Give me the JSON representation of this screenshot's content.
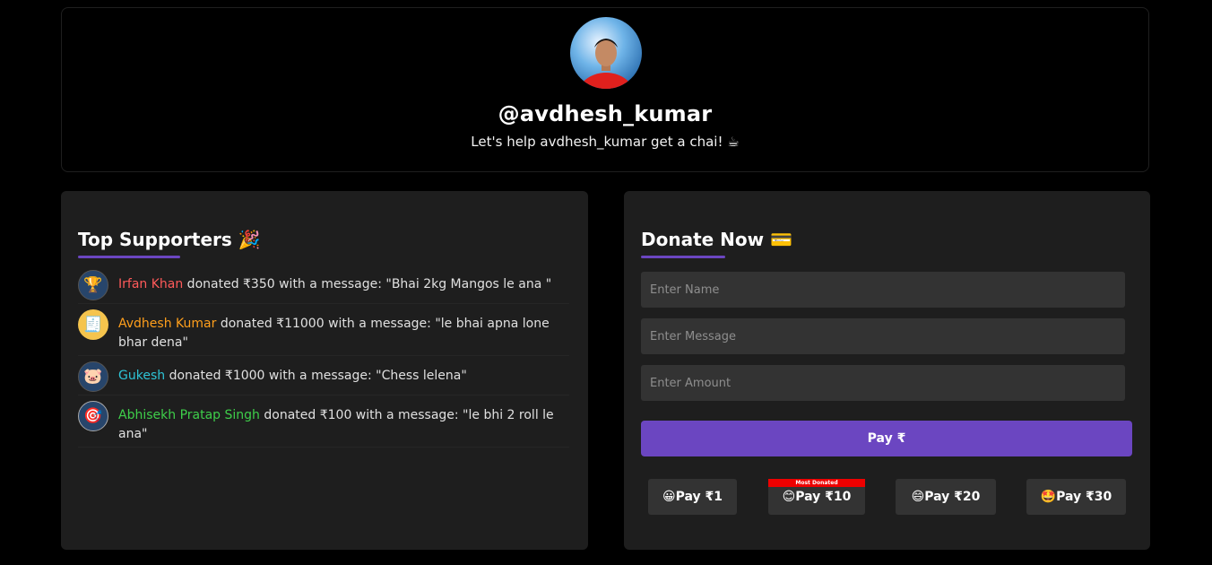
{
  "profile": {
    "username": "@avdhesh_kumar",
    "tagline": "Let's help avdhesh_kumar get a chai! ☕"
  },
  "supporters_panel": {
    "title": "Top Supporters 🎉",
    "items": [
      {
        "icon": "trophy-icon",
        "emoji": "🏆",
        "name": "Irfan Khan",
        "name_color": "#ff5a5a",
        "amount_text": " donated ₹350 with a message: \"Bhai 2kg Mangos le ana \""
      },
      {
        "icon": "receipt-icon",
        "emoji": "🧾",
        "name": "Avdhesh Kumar",
        "name_color": "#ff9f1c",
        "amount_text": " donated ₹11000 with a message: \"le bhai apna lone bhar dena\""
      },
      {
        "icon": "piggy-bank-icon",
        "emoji": "🐷",
        "name": "Gukesh",
        "name_color": "#2ec4d6",
        "amount_text": " donated ₹1000 with a message: \"Chess lelena\""
      },
      {
        "icon": "target-icon",
        "emoji": "🎯",
        "name": "Abhisekh Pratap Singh",
        "name_color": "#3ecf4a",
        "amount_text": " donated ₹100 with a message: \"le bhi 2 roll le ana\""
      }
    ]
  },
  "donate_panel": {
    "title": "Donate Now 💳",
    "name_placeholder": "Enter Name",
    "message_placeholder": "Enter Message",
    "amount_placeholder": "Enter Amount",
    "pay_label": "Pay ₹",
    "quick_pay": [
      {
        "label": "😀Pay ₹1"
      },
      {
        "label": "😊Pay ₹10",
        "badge": "Most Donated"
      },
      {
        "label": "😄Pay ₹20"
      },
      {
        "label": "🤩Pay ₹30"
      }
    ]
  },
  "colors": {
    "accent": "#6b46c1",
    "badge": "#e00000",
    "panel": "#1e1e1e",
    "input": "#333333"
  }
}
